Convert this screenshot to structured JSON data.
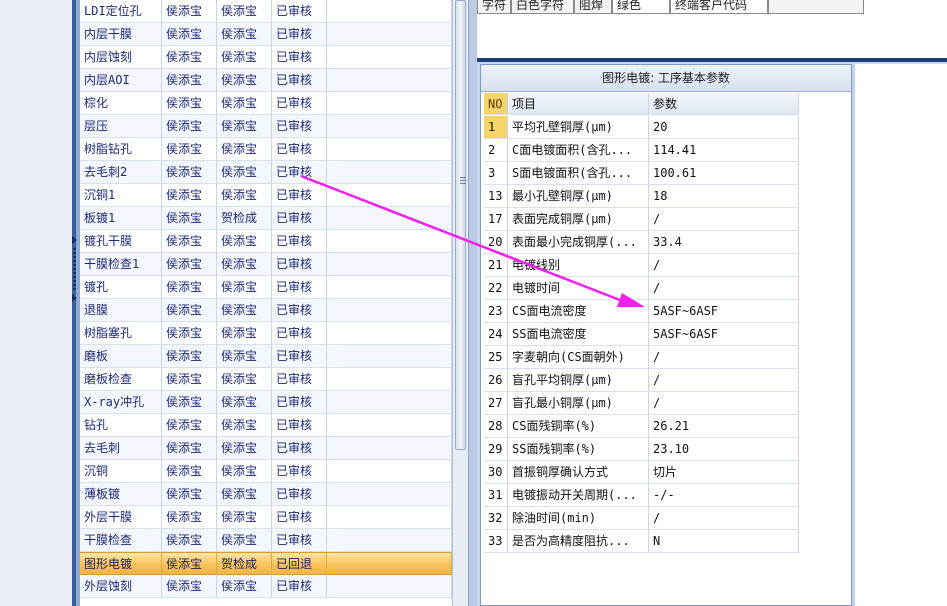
{
  "top_tabs": [
    "字符",
    "白色字符",
    "阻焊",
    "绿色",
    "终端客户代码",
    ""
  ],
  "left_grid": {
    "rows": [
      {
        "process": "LDI定位孔",
        "c2": "侯添宝",
        "c3": "侯添宝",
        "status": "已审核"
      },
      {
        "process": "内层干膜",
        "c2": "侯添宝",
        "c3": "侯添宝",
        "status": "已审核"
      },
      {
        "process": "内层蚀刻",
        "c2": "侯添宝",
        "c3": "侯添宝",
        "status": "已审核"
      },
      {
        "process": "内层AOI",
        "c2": "侯添宝",
        "c3": "侯添宝",
        "status": "已审核"
      },
      {
        "process": "棕化",
        "c2": "侯添宝",
        "c3": "侯添宝",
        "status": "已审核"
      },
      {
        "process": "层压",
        "c2": "侯添宝",
        "c3": "侯添宝",
        "status": "已审核"
      },
      {
        "process": "树脂钻孔",
        "c2": "侯添宝",
        "c3": "侯添宝",
        "status": "已审核"
      },
      {
        "process": "去毛刺2",
        "c2": "侯添宝",
        "c3": "侯添宝",
        "status": "已审核"
      },
      {
        "process": "沉铜1",
        "c2": "侯添宝",
        "c3": "侯添宝",
        "status": "已审核"
      },
      {
        "process": "板镀1",
        "c2": "侯添宝",
        "c3": "贺检成",
        "status": "已审核"
      },
      {
        "process": "镀孔干膜",
        "c2": "侯添宝",
        "c3": "侯添宝",
        "status": "已审核"
      },
      {
        "process": "干膜检查1",
        "c2": "侯添宝",
        "c3": "侯添宝",
        "status": "已审核"
      },
      {
        "process": "镀孔",
        "c2": "侯添宝",
        "c3": "侯添宝",
        "status": "已审核"
      },
      {
        "process": "退膜",
        "c2": "侯添宝",
        "c3": "侯添宝",
        "status": "已审核"
      },
      {
        "process": "树脂塞孔",
        "c2": "侯添宝",
        "c3": "侯添宝",
        "status": "已审核"
      },
      {
        "process": "磨板",
        "c2": "侯添宝",
        "c3": "侯添宝",
        "status": "已审核"
      },
      {
        "process": "磨板检查",
        "c2": "侯添宝",
        "c3": "侯添宝",
        "status": "已审核"
      },
      {
        "process": "X-ray冲孔",
        "c2": "侯添宝",
        "c3": "侯添宝",
        "status": "已审核"
      },
      {
        "process": "钻孔",
        "c2": "侯添宝",
        "c3": "侯添宝",
        "status": "已审核"
      },
      {
        "process": "去毛刺",
        "c2": "侯添宝",
        "c3": "侯添宝",
        "status": "已审核"
      },
      {
        "process": "沉铜",
        "c2": "侯添宝",
        "c3": "侯添宝",
        "status": "已审核"
      },
      {
        "process": "薄板镀",
        "c2": "侯添宝",
        "c3": "侯添宝",
        "status": "已审核"
      },
      {
        "process": "外层干膜",
        "c2": "侯添宝",
        "c3": "侯添宝",
        "status": "已审核"
      },
      {
        "process": "干膜检查",
        "c2": "侯添宝",
        "c3": "侯添宝",
        "status": "已审核"
      },
      {
        "process": "图形电镀",
        "c2": "侯添宝",
        "c3": "贺检成",
        "status": "已回退"
      },
      {
        "process": "外层蚀刻",
        "c2": "侯添宝",
        "c3": "侯添宝",
        "status": "已审核"
      }
    ],
    "selected_index": 24
  },
  "params_panel": {
    "title": "图形电镀: 工序基本参数",
    "headers": {
      "no": "NO",
      "item": "项目",
      "value": "参数"
    },
    "rows": [
      {
        "no": "1",
        "item": "平均孔壁铜厚(μm)",
        "value": "20"
      },
      {
        "no": "2",
        "item": "C面电镀面积(含孔...",
        "value": "114.41"
      },
      {
        "no": "3",
        "item": "S面电镀面积(含孔...",
        "value": "100.61"
      },
      {
        "no": "13",
        "item": "最小孔壁铜厚(μm)",
        "value": "18"
      },
      {
        "no": "17",
        "item": "表面完成铜厚(μm)",
        "value": "/"
      },
      {
        "no": "20",
        "item": "表面最小完成铜厚(...",
        "value": "33.4"
      },
      {
        "no": "21",
        "item": "电镀线别",
        "value": "/"
      },
      {
        "no": "22",
        "item": "电镀时间",
        "value": "/"
      },
      {
        "no": "23",
        "item": "CS面电流密度",
        "value": "5ASF~6ASF"
      },
      {
        "no": "24",
        "item": "SS面电流密度",
        "value": "5ASF~6ASF"
      },
      {
        "no": "25",
        "item": "字麦朝向(CS面朝外)",
        "value": "/"
      },
      {
        "no": "26",
        "item": "盲孔平均铜厚(μm)",
        "value": "/"
      },
      {
        "no": "27",
        "item": "盲孔最小铜厚(μm)",
        "value": "/"
      },
      {
        "no": "28",
        "item": "CS面残铜率(%)",
        "value": "26.21"
      },
      {
        "no": "29",
        "item": "SS面残铜率(%)",
        "value": "23.10"
      },
      {
        "no": "30",
        "item": "首振铜厚确认方式",
        "value": "切片"
      },
      {
        "no": "31",
        "item": "电镀振动开关周期(...",
        "value": "-/-"
      },
      {
        "no": "32",
        "item": "除油时间(min)",
        "value": "/"
      },
      {
        "no": "33",
        "item": "是否为高精度阻抗...",
        "value": "N"
      }
    ],
    "highlight_no_index": 0
  },
  "annotation_arrow_color": "#f020f0"
}
